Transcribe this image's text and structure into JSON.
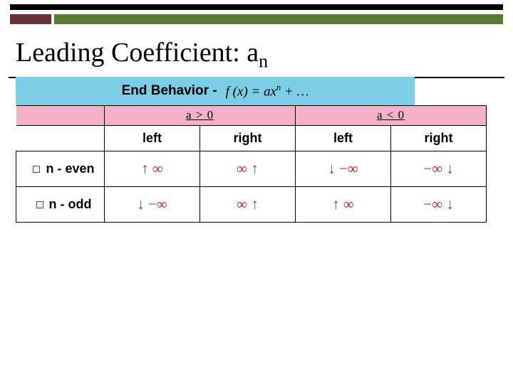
{
  "title_main": "Leading Coefficient:  a",
  "title_sub": "n",
  "end_behavior_label": "End Behavior -",
  "formula_html": "f (x) = ax",
  "formula_sup": "n",
  "formula_tail": " + …",
  "columns": {
    "a_pos": "a > 0",
    "a_neg": "a < 0",
    "left": "left",
    "right": "right"
  },
  "rows": {
    "even": "n - even",
    "odd": "n - odd"
  },
  "chart_data": {
    "type": "table",
    "title": "End Behavior - f(x) = ax^n + …",
    "row_labels": [
      "n - even",
      "n - odd"
    ],
    "column_groups": [
      {
        "label": "a > 0",
        "subcolumns": [
          "left",
          "right"
        ]
      },
      {
        "label": "a < 0",
        "subcolumns": [
          "left",
          "right"
        ]
      }
    ],
    "cells": {
      "n_even": {
        "a_pos_left": "↑ ∞",
        "a_pos_right": "∞ ↑",
        "a_neg_left": "↓ −∞",
        "a_neg_right": "−∞ ↓"
      },
      "n_odd": {
        "a_pos_left": "↓ −∞",
        "a_pos_right": "∞ ↑",
        "a_neg_left": "↑ ∞",
        "a_neg_right": "−∞ ↓"
      }
    }
  }
}
